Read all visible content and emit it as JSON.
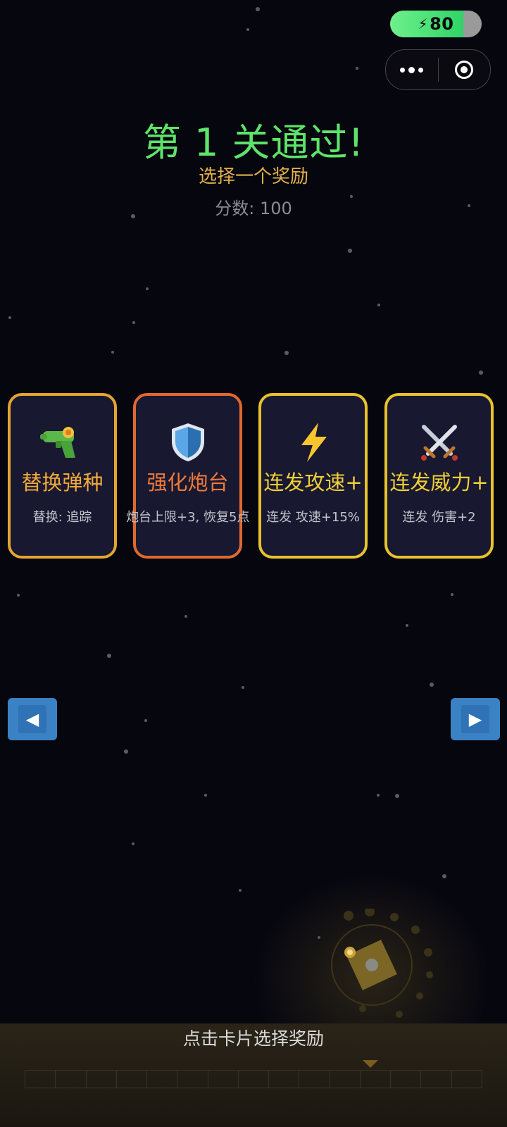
{
  "status": {
    "battery_value": "80",
    "battery_level_percent": 80
  },
  "level": {
    "title": "第 1 关通过!",
    "subtitle": "选择一个奖励",
    "score_text": "分数: 100"
  },
  "cards": [
    {
      "icon": "water-gun-icon",
      "name": "替换弹种",
      "desc": "替换: 追踪",
      "border_color": "#e3a531",
      "name_color": "#f2a93a"
    },
    {
      "icon": "shield-icon",
      "name": "强化炮台",
      "desc": "炮台上限+3, 恢复5点",
      "border_color": "#e0682e",
      "name_color": "#ef7a3a"
    },
    {
      "icon": "lightning-icon",
      "name": "连发攻速+",
      "desc": "连发 攻速+15%",
      "border_color": "#e8c22c",
      "name_color": "#f2cf36"
    },
    {
      "icon": "crossed-swords-icon",
      "name": "连发威力+",
      "desc": "连发 伤害+2",
      "border_color": "#e8c22c",
      "name_color": "#f2cf36"
    }
  ],
  "nav": {
    "prev_glyph": "◀",
    "next_glyph": "▶"
  },
  "footer": {
    "hint": "点击卡片选择奖励"
  }
}
